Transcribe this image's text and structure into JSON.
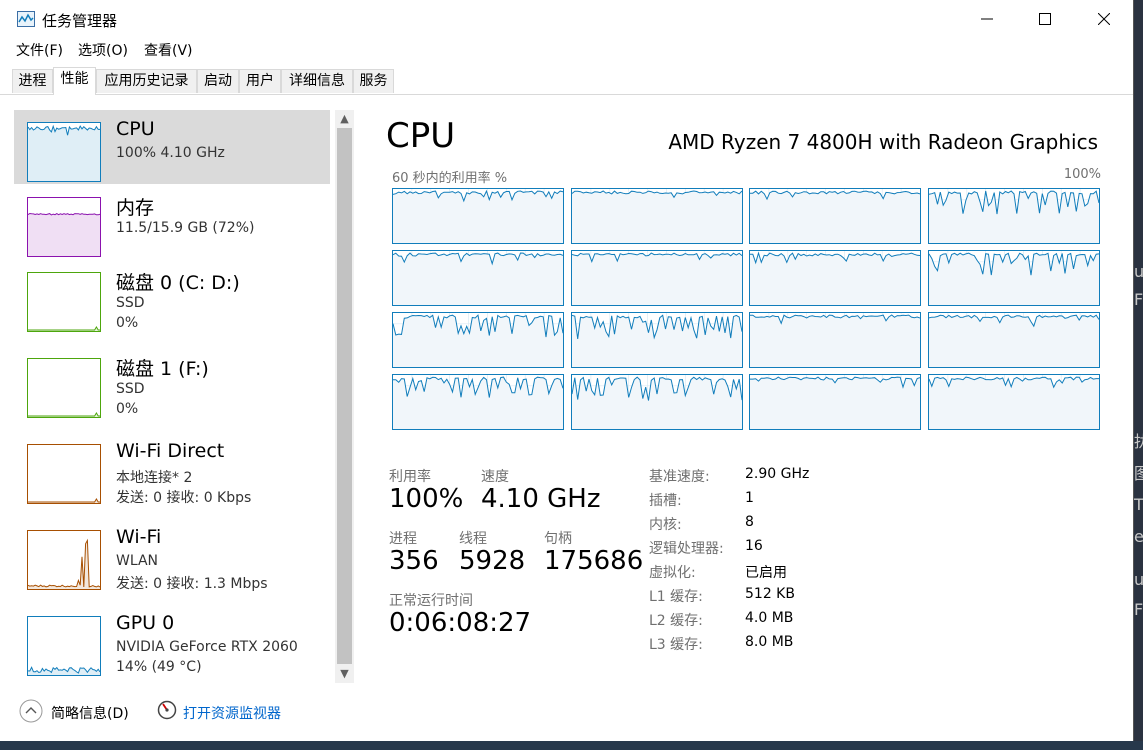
{
  "window": {
    "title": "任务管理器"
  },
  "menu": [
    "文件(F)",
    "选项(O)",
    "查看(V)"
  ],
  "tabs": [
    "进程",
    "性能",
    "应用历史记录",
    "启动",
    "用户",
    "详细信息",
    "服务"
  ],
  "active_tab": "性能",
  "sidebar": [
    {
      "name": "CPU",
      "line1": "100% 4.10 GHz",
      "line2": "",
      "color": "#117dbb",
      "usage": 1.0
    },
    {
      "name": "内存",
      "line1": "11.5/15.9 GB (72%)",
      "line2": "",
      "color": "#8b12ae",
      "usage": 0.72
    },
    {
      "name": "磁盘 0 (C: D:)",
      "line1": "SSD",
      "line2": "0%",
      "color": "#4da60c",
      "usage": 0.0
    },
    {
      "name": "磁盘 1 (F:)",
      "line1": "SSD",
      "line2": "0%",
      "color": "#4da60c",
      "usage": 0.0
    },
    {
      "name": "Wi-Fi Direct",
      "line1": "本地连接* 2",
      "line2": "发送: 0 接收: 0 Kbps",
      "color": "#a74f01",
      "usage": 0.0
    },
    {
      "name": "Wi-Fi",
      "line1": "WLAN",
      "line2": "发送: 0 接收: 1.3 Mbps",
      "color": "#a74f01",
      "usage": 0.3
    },
    {
      "name": "GPU 0",
      "line1": "NVIDIA GeForce RTX 2060",
      "line2": "14% (49 °C)",
      "color": "#117dbb",
      "usage": 0.14
    }
  ],
  "main": {
    "title": "CPU",
    "model": "AMD Ryzen 7 4800H with Radeon Graphics",
    "util_label": "60 秒内的利用率 %",
    "util_max": "100%",
    "stats": {
      "util_label": "利用率",
      "util_value": "100%",
      "speed_label": "速度",
      "speed_value": "4.10 GHz",
      "proc_label": "进程",
      "proc_value": "356",
      "thread_label": "线程",
      "thread_value": "5928",
      "handle_label": "句柄",
      "handle_value": "175686",
      "uptime_label": "正常运行时间",
      "uptime_value": "0:06:08:27"
    },
    "specs": [
      {
        "k": "基准速度:",
        "v": "2.90 GHz"
      },
      {
        "k": "插槽:",
        "v": "1"
      },
      {
        "k": "内核:",
        "v": "8"
      },
      {
        "k": "逻辑处理器:",
        "v": "16"
      },
      {
        "k": "虚拟化:",
        "v": "已启用"
      },
      {
        "k": "L1 缓存:",
        "v": "512 KB"
      },
      {
        "k": "L2 缓存:",
        "v": "4.0 MB"
      },
      {
        "k": "L3 缓存:",
        "v": "8.0 MB"
      }
    ]
  },
  "footer": {
    "summary": "简略信息(D)",
    "monitor": "打开资源监视器"
  },
  "colors": {
    "cpu_line": "#117dbb",
    "cpu_fill": "#f1f6fa",
    "grid": "#d9eaf4",
    "selected": "#dadada"
  }
}
